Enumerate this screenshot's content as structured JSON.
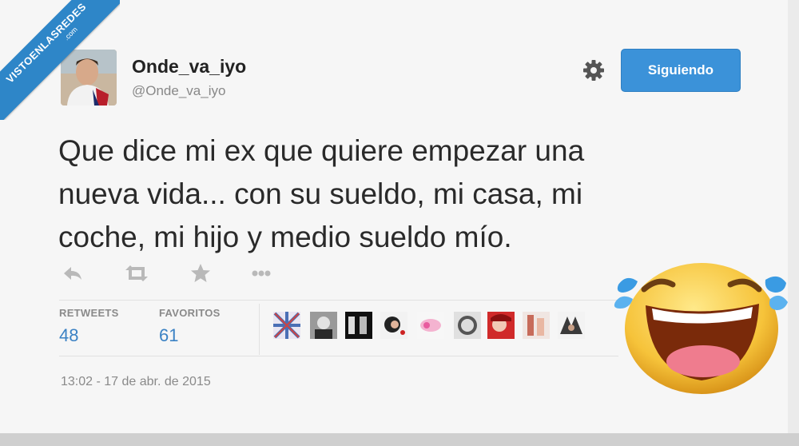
{
  "watermark": {
    "line1": "VISTOENLASREDES",
    "line2": ".com"
  },
  "user": {
    "display_name": "Onde_va_iyo",
    "handle": "@Onde_va_iyo"
  },
  "follow_button": {
    "label": "Siguiendo"
  },
  "tweet": {
    "text_lines": [
      "Que dice mi ex que quiere empezar una",
      "nueva vida... con su sueldo, mi casa, mi",
      "coche, mi hijo y medio sueldo mío."
    ]
  },
  "actions": [
    {
      "name": "reply-icon"
    },
    {
      "name": "retweet-icon"
    },
    {
      "name": "favorite-icon"
    },
    {
      "name": "more-icon"
    }
  ],
  "stats": {
    "retweets_label": "RETWEETS",
    "retweets_value": "48",
    "favorites_label": "FAVORITOS",
    "favorites_value": "61"
  },
  "timestamp": "13:02 - 17 de abr. de 2015",
  "colors": {
    "accent": "#3b92d9",
    "stat_value": "#3b82c4",
    "ribbon": "#2e86c8"
  }
}
